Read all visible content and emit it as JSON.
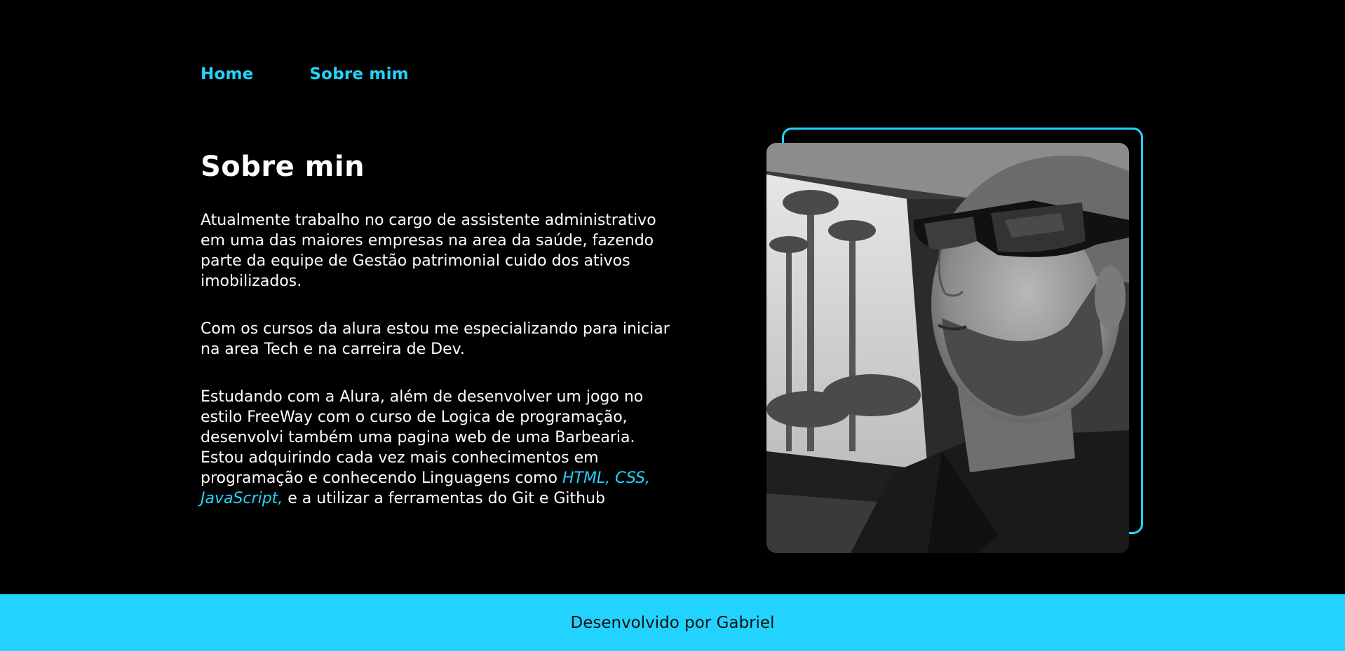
{
  "nav": {
    "items": [
      {
        "label": "Home"
      },
      {
        "label": "Sobre mim"
      }
    ]
  },
  "about": {
    "title": "Sobre min",
    "paragraph1": "Atualmente trabalho no cargo de assistente administrativo em uma das maiores empresas na area da saúde, fazendo parte da equipe de Gestão patrimonial cuido dos ativos imobilizados.",
    "paragraph2": "Com os cursos da alura estou me especializando para iniciar na area Tech e na carreira de Dev.",
    "paragraph3_before": "Estudando com a Alura, além de desenvolver um jogo no estilo FreeWay com o curso de Logica de programação, desenvolvi também uma pagina web de uma Barbearia. Estou adquirindo cada vez mais conhecimentos em programação e conhecendo Linguagens como ",
    "paragraph3_highlight": "HTML, CSS, JavaScript,",
    "paragraph3_after": " e a utilizar a ferramentas do Git e Github"
  },
  "photo": {
    "icon": "profile-photo"
  },
  "footer": {
    "text": "Desenvolvido por Gabriel"
  },
  "colors": {
    "accent": "#22d3ff",
    "background": "#000000",
    "text": "#ffffff"
  }
}
